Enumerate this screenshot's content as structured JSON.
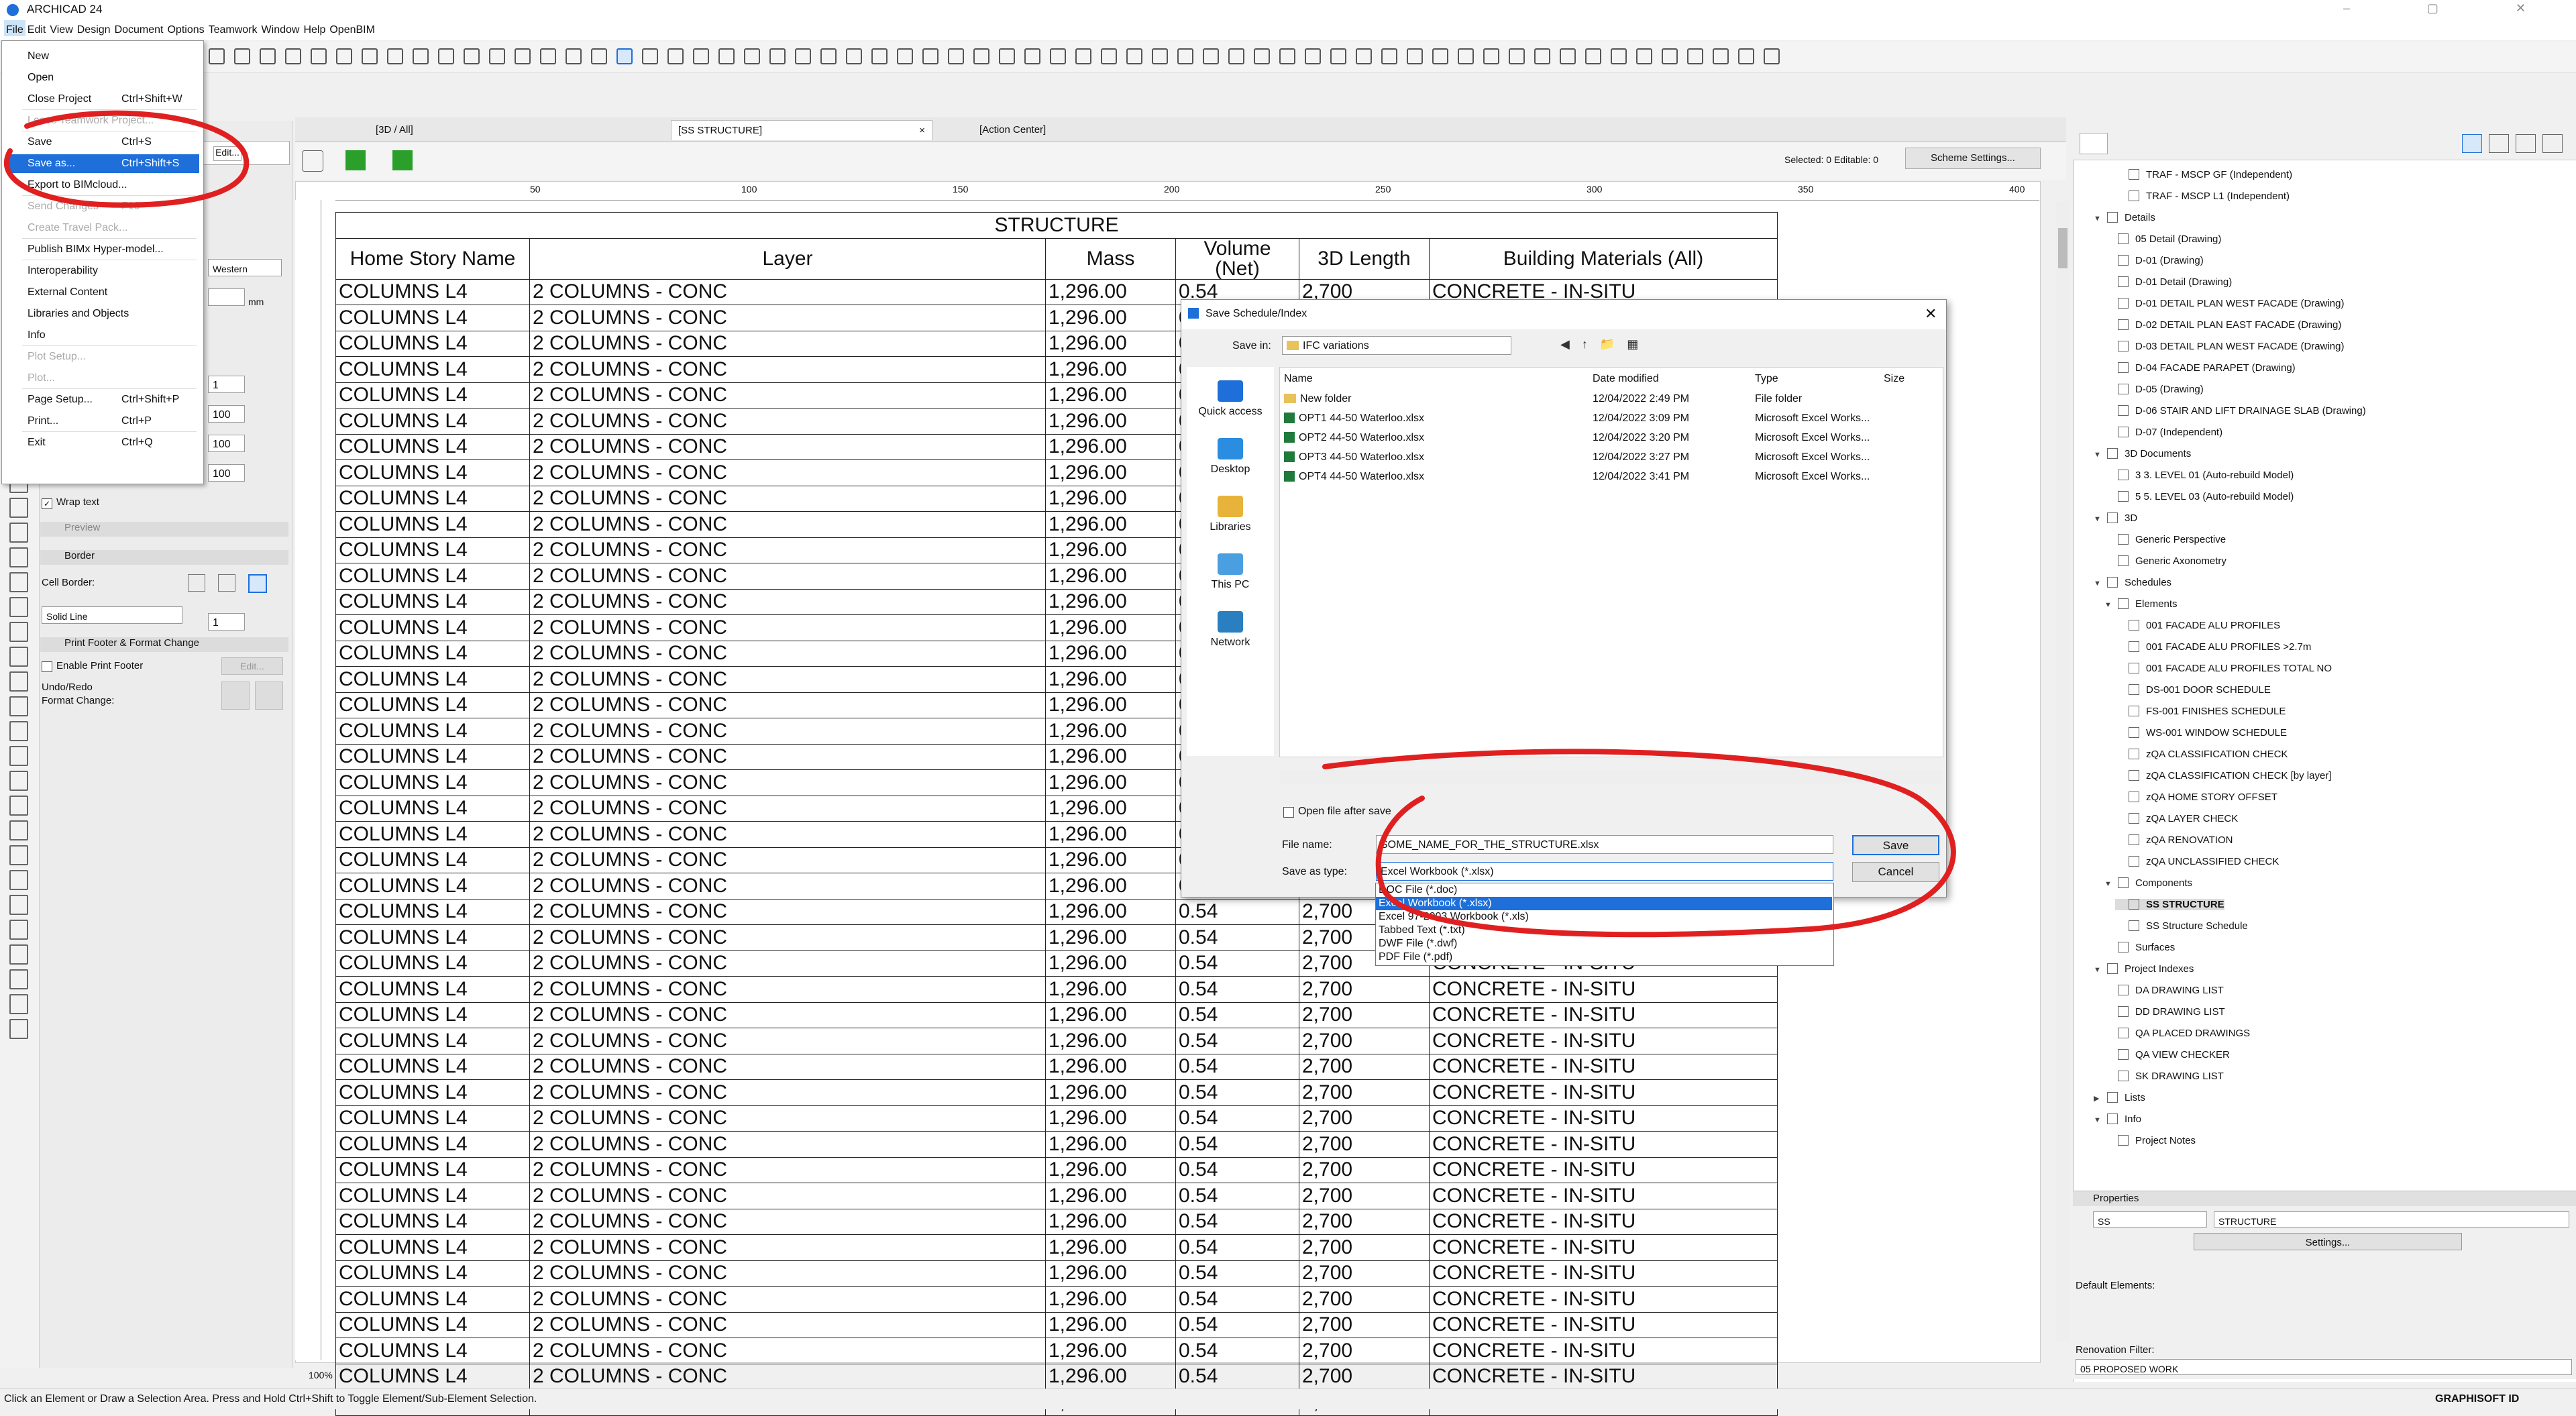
{
  "window": {
    "title": "ARCHICAD 24"
  },
  "menubar": [
    "File",
    "Edit",
    "View",
    "Design",
    "Document",
    "Options",
    "Teamwork",
    "Window",
    "Help",
    "OpenBIM"
  ],
  "file_menu": {
    "items": [
      {
        "label": "New",
        "shortcut": "",
        "disabled": false
      },
      {
        "label": "Open",
        "shortcut": "",
        "disabled": false
      },
      {
        "label": "Close Project",
        "shortcut": "Ctrl+Shift+W",
        "disabled": false
      },
      {
        "label": "Leave Teamwork Project...",
        "shortcut": "",
        "disabled": true
      },
      {
        "label": "Save",
        "shortcut": "Ctrl+S",
        "disabled": false
      },
      {
        "label": "Save as...",
        "shortcut": "Ctrl+Shift+S",
        "disabled": false
      },
      {
        "label": "Export to BIMcloud...",
        "shortcut": "",
        "disabled": false
      },
      {
        "label": "Send Changes",
        "shortcut": "F10",
        "disabled": true
      },
      {
        "label": "Create Travel Pack...",
        "shortcut": "",
        "disabled": true
      },
      {
        "label": "Publish BIMx Hyper-model...",
        "shortcut": "",
        "disabled": false
      },
      {
        "label": "Interoperability",
        "shortcut": "",
        "disabled": false
      },
      {
        "label": "External Content",
        "shortcut": "",
        "disabled": false
      },
      {
        "label": "Libraries and Objects",
        "shortcut": "",
        "disabled": false
      },
      {
        "label": "Info",
        "shortcut": "",
        "disabled": false
      },
      {
        "label": "Plot Setup...",
        "shortcut": "",
        "disabled": true
      },
      {
        "label": "Plot...",
        "shortcut": "",
        "disabled": true
      },
      {
        "label": "Page Setup...",
        "shortcut": "Ctrl+Shift+P",
        "disabled": false
      },
      {
        "label": "Print...",
        "shortcut": "Ctrl+P",
        "disabled": false
      },
      {
        "label": "Exit",
        "shortcut": "Ctrl+Q",
        "disabled": false
      }
    ]
  },
  "tabs": [
    "[3D / All]",
    "[SS STRUCTURE]",
    "[Action Center]"
  ],
  "schedule_toolbar": {
    "selected": "Selected: 0  Editable: 0",
    "scheme_button": "Scheme Settings..."
  },
  "ruler": [
    "50",
    "100",
    "150",
    "200",
    "250",
    "300",
    "350",
    "400"
  ],
  "schedule": {
    "title": "STRUCTURE",
    "headers": [
      "Home Story Name",
      "Layer",
      "Mass",
      "Volume (Net)",
      "3D Length",
      "Building Materials (All)"
    ],
    "row": {
      "story": "COLUMNS L4",
      "layer": "2 COLUMNS - CONC",
      "mass": "1,296.00",
      "volume": "0.54",
      "length": "2,700",
      "material": "CONCRETE - IN-SITU"
    },
    "row_count": 44
  },
  "infobox": {
    "wrap_text": "Wrap text",
    "preview": "Preview",
    "border": "Border",
    "cell_border": "Cell Border:",
    "line_type": "Solid Line",
    "print_footer": "Print Footer & Format Change",
    "enable_footer": "Enable Print Footer",
    "edit": "Edit...",
    "undo_redo": "Undo/Redo",
    "format_change": "Format Change:",
    "font": "Western",
    "unit": "mm",
    "values": [
      "1",
      "100",
      "100",
      "100",
      "1"
    ]
  },
  "dialog": {
    "title": "Save Schedule/Index",
    "save_in_label": "Save in:",
    "save_in_value": "IFC variations",
    "places": [
      "Quick access",
      "Desktop",
      "Libraries",
      "This PC",
      "Network"
    ],
    "columns": [
      "Name",
      "Date modified",
      "Type",
      "Size"
    ],
    "files": [
      {
        "name": "New folder",
        "date": "12/04/2022 2:49 PM",
        "type": "File folder",
        "kind": "folder"
      },
      {
        "name": "OPT1 44-50 Waterloo.xlsx",
        "date": "12/04/2022 3:09 PM",
        "type": "Microsoft Excel Works...",
        "kind": "xlsx"
      },
      {
        "name": "OPT2 44-50 Waterloo.xlsx",
        "date": "12/04/2022 3:20 PM",
        "type": "Microsoft Excel Works...",
        "kind": "xlsx"
      },
      {
        "name": "OPT3 44-50 Waterloo.xlsx",
        "date": "12/04/2022 3:27 PM",
        "type": "Microsoft Excel Works...",
        "kind": "xlsx"
      },
      {
        "name": "OPT4 44-50 Waterloo.xlsx",
        "date": "12/04/2022 3:41 PM",
        "type": "Microsoft Excel Works...",
        "kind": "xlsx"
      }
    ],
    "open_after_save": "Open file after save",
    "file_name_label": "File name:",
    "file_name_value": "SOME_NAME_FOR_THE_STRUCTURE.xlsx",
    "save_as_type_label": "Save as type:",
    "save_as_type_value": "Excel Workbook (*.xlsx)",
    "type_options": [
      "DOC File (*.doc)",
      "Excel Workbook (*.xlsx)",
      "Excel 97-2003 Workbook (*.xls)",
      "Tabbed Text (*.txt)",
      "DWF File (*.dwf)",
      "PDF File (*.pdf)"
    ],
    "selected_type_index": 1,
    "save_button": "Save",
    "cancel_button": "Cancel"
  },
  "navigator": {
    "items": [
      {
        "label": "TRAF - MSCP GF (Independent)",
        "level": 3,
        "icon": "drawing"
      },
      {
        "label": "TRAF - MSCP L1 (Independent)",
        "level": 3,
        "icon": "drawing"
      },
      {
        "label": "Details",
        "level": 1,
        "icon": "folder",
        "toggle": "v"
      },
      {
        "label": "05 Detail (Drawing)",
        "level": 2,
        "icon": "detail"
      },
      {
        "label": "D-01 (Drawing)",
        "level": 2,
        "icon": "detail"
      },
      {
        "label": "D-01 Detail (Drawing)",
        "level": 2,
        "icon": "detail"
      },
      {
        "label": "D-01 DETAIL PLAN WEST FACADE (Drawing)",
        "level": 2,
        "icon": "detail"
      },
      {
        "label": "D-02 DETAIL PLAN EAST FACADE (Drawing)",
        "level": 2,
        "icon": "detail"
      },
      {
        "label": "D-03 DETAIL PLAN WEST FACADE (Drawing)",
        "level": 2,
        "icon": "detail"
      },
      {
        "label": "D-04 FACADE PARAPET  (Drawing)",
        "level": 2,
        "icon": "detail"
      },
      {
        "label": "D-05 (Drawing)",
        "level": 2,
        "icon": "detail"
      },
      {
        "label": "D-06 STAIR AND LIFT DRAINAGE SLAB (Drawing)",
        "level": 2,
        "icon": "detail"
      },
      {
        "label": "D-07 (Independent)",
        "level": 2,
        "icon": "detail"
      },
      {
        "label": "3D Documents",
        "level": 1,
        "icon": "folder",
        "toggle": "v"
      },
      {
        "label": "3 3. LEVEL 01 (Auto-rebuild Model)",
        "level": 2,
        "icon": "doc"
      },
      {
        "label": "5 5. LEVEL 03 (Auto-rebuild Model)",
        "level": 2,
        "icon": "doc"
      },
      {
        "label": "3D",
        "level": 1,
        "icon": "folder",
        "toggle": "v"
      },
      {
        "label": "Generic Perspective",
        "level": 2,
        "icon": "camera"
      },
      {
        "label": "Generic Axonometry",
        "level": 2,
        "icon": "camera"
      },
      {
        "label": "Schedules",
        "level": 1,
        "icon": "folder",
        "toggle": "v"
      },
      {
        "label": "Elements",
        "level": 2,
        "icon": "folder",
        "toggle": "v"
      },
      {
        "label": "001 FACADE ALU PROFILES",
        "level": 3,
        "icon": "table"
      },
      {
        "label": "001 FACADE ALU PROFILES >2.7m",
        "level": 3,
        "icon": "table"
      },
      {
        "label": "001 FACADE ALU PROFILES TOTAL NO",
        "level": 3,
        "icon": "table"
      },
      {
        "label": "DS-001 DOOR SCHEDULE",
        "level": 3,
        "icon": "table"
      },
      {
        "label": "FS-001 FINISHES SCHEDULE",
        "level": 3,
        "icon": "table"
      },
      {
        "label": "WS-001 WINDOW SCHEDULE",
        "level": 3,
        "icon": "table"
      },
      {
        "label": "zQA CLASSIFICATION CHECK",
        "level": 3,
        "icon": "table"
      },
      {
        "label": "zQA CLASSIFICATION CHECK [by layer]",
        "level": 3,
        "icon": "table"
      },
      {
        "label": "zQA HOME STORY OFFSET",
        "level": 3,
        "icon": "table"
      },
      {
        "label": "zQA LAYER CHECK",
        "level": 3,
        "icon": "table"
      },
      {
        "label": "zQA RENOVATION",
        "level": 3,
        "icon": "table"
      },
      {
        "label": "zQA UNCLASSIFIED CHECK",
        "level": 3,
        "icon": "table"
      },
      {
        "label": "Components",
        "level": 2,
        "icon": "folder",
        "toggle": "v"
      },
      {
        "label": "SS STRUCTURE",
        "level": 3,
        "icon": "table",
        "selected": true
      },
      {
        "label": "SS Structure Schedule",
        "level": 3,
        "icon": "table"
      },
      {
        "label": "Surfaces",
        "level": 2,
        "icon": "folder"
      },
      {
        "label": "Project Indexes",
        "level": 1,
        "icon": "folder",
        "toggle": "v"
      },
      {
        "label": "DA DRAWING LIST",
        "level": 2,
        "icon": "table"
      },
      {
        "label": "DD DRAWING LIST",
        "level": 2,
        "icon": "table"
      },
      {
        "label": "QA PLACED DRAWINGS",
        "level": 2,
        "icon": "table"
      },
      {
        "label": "QA VIEW CHECKER",
        "level": 2,
        "icon": "table"
      },
      {
        "label": "SK DRAWING LIST",
        "level": 2,
        "icon": "table"
      },
      {
        "label": "Lists",
        "level": 1,
        "icon": "folder",
        "toggle": ">"
      },
      {
        "label": "Info",
        "level": 1,
        "icon": "folder",
        "toggle": "v"
      },
      {
        "label": "Project Notes",
        "level": 2,
        "icon": "doc"
      }
    ]
  },
  "properties": {
    "header": "Properties",
    "id": "SS",
    "name": "STRUCTURE",
    "settings": "Settings...",
    "default_elements": "Default Elements:",
    "renovation_filter": "Renovation Filter:",
    "renovation_value": "05 PROPOSED WORK"
  },
  "status": {
    "message": "Click an Element or Draw a Selection Area. Press and Hold Ctrl+Shift to Toggle Element/Sub-Element Selection.",
    "zoom": "100%",
    "brand": "GRAPHISOFT ID"
  },
  "annotation_color": "#e02020",
  "accent_color": "#1e6fd9"
}
